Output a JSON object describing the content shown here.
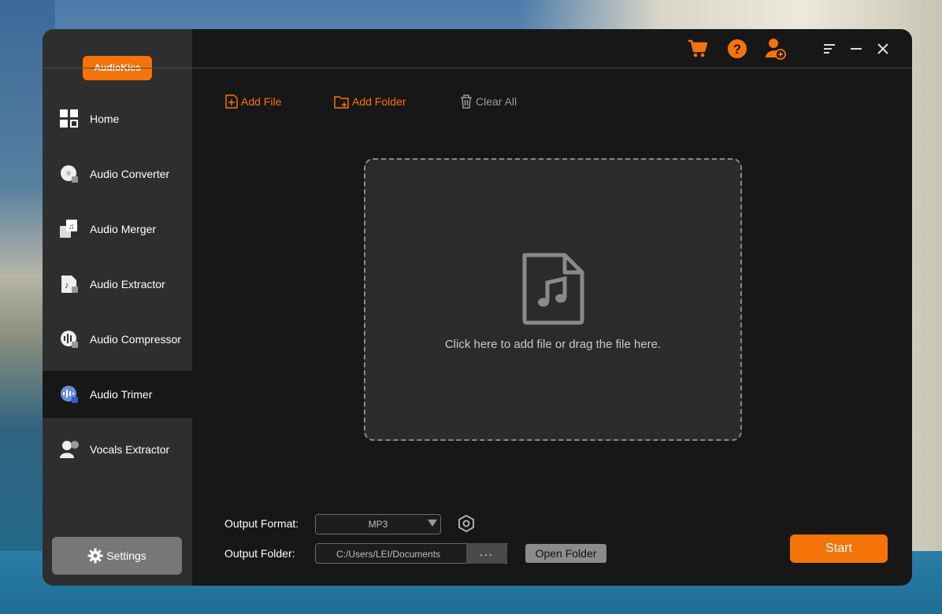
{
  "app": {
    "logo": "AudioKies"
  },
  "sidebar": {
    "items": [
      {
        "label": "Home",
        "icon": "home-grid-icon"
      },
      {
        "label": "Audio Converter",
        "icon": "audio-converter-icon"
      },
      {
        "label": "Audio Merger",
        "icon": "audio-merger-icon"
      },
      {
        "label": "Audio Extractor",
        "icon": "audio-extractor-icon"
      },
      {
        "label": "Audio Compressor",
        "icon": "audio-compressor-icon"
      },
      {
        "label": "Audio Trimer",
        "icon": "audio-trimmer-icon",
        "active": true
      },
      {
        "label": "Vocals Extractor",
        "icon": "vocals-extractor-icon"
      }
    ],
    "settings_label": "Settings"
  },
  "topbar": {
    "icons": [
      "cart-icon",
      "help-icon",
      "user-add-icon",
      "menu-icon",
      "minimize-icon",
      "close-icon"
    ]
  },
  "toolbar": {
    "add_file": "Add File",
    "add_folder": "Add Folder",
    "clear_all": "Clear All"
  },
  "dropzone": {
    "text": "Click here to add file or drag the file here."
  },
  "output": {
    "format_label": "Output Format:",
    "format_value": "MP3",
    "folder_label": "Output Folder:",
    "folder_value": "C:/Users/LEI/Documents",
    "browse_label": "...",
    "open_folder_label": "Open Folder"
  },
  "start_label": "Start",
  "colors": {
    "accent": "#f5740a",
    "sidebar": "#2e2e2e",
    "main": "#171717"
  }
}
